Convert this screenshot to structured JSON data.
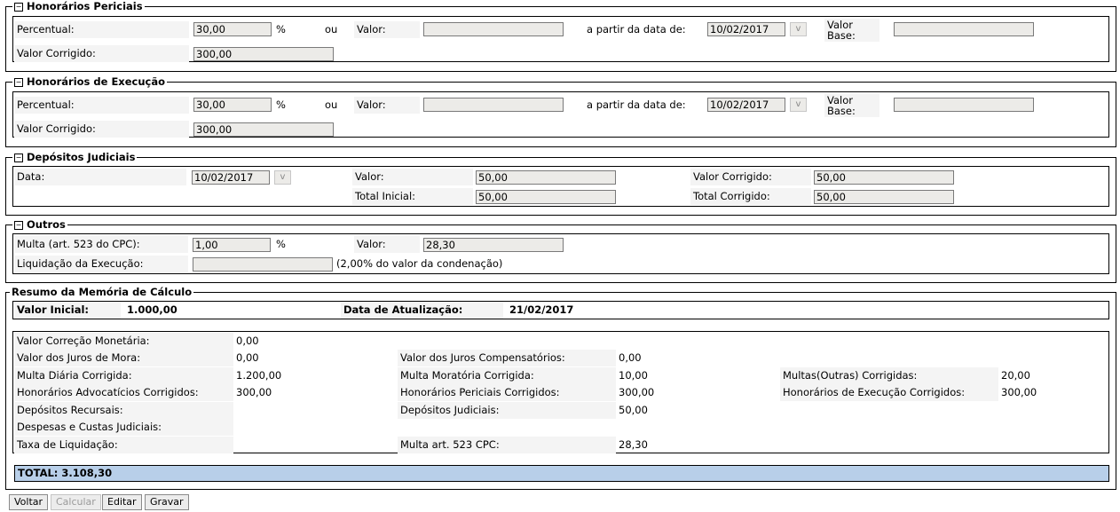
{
  "honorarios_periciais": {
    "legend": "Honorários Periciais",
    "toggle": "−",
    "percentual_label": "Percentual:",
    "percentual_value": "30,00",
    "percent_sign": "%",
    "ou": "ou",
    "valor_label": "Valor:",
    "valor_value": "",
    "data_label": "a partir da data de:",
    "data_value": "10/02/2017",
    "date_btn": "v",
    "valor_base_label_1": "Valor",
    "valor_base_label_2": "Base:",
    "valor_base_value": "",
    "valor_corrigido_label": "Valor Corrigido:",
    "valor_corrigido_value": "300,00"
  },
  "honorarios_execucao": {
    "legend": "Honorários de Execução",
    "toggle": "−",
    "percentual_label": "Percentual:",
    "percentual_value": "30,00",
    "percent_sign": "%",
    "ou": "ou",
    "valor_label": "Valor:",
    "valor_value": "",
    "data_label": "a partir da data de:",
    "data_value": "10/02/2017",
    "date_btn": "v",
    "valor_base_label_1": "Valor",
    "valor_base_label_2": "Base:",
    "valor_base_value": "",
    "valor_corrigido_label": "Valor Corrigido:",
    "valor_corrigido_value": "300,00"
  },
  "depositos_judiciais": {
    "legend": "Depósitos Judiciais",
    "toggle": "−",
    "data_label": "Data:",
    "data_value": "10/02/2017",
    "date_btn": "v",
    "valor_label": "Valor:",
    "valor_value": "50,00",
    "valor_corrigido_label": "Valor Corrigido:",
    "valor_corrigido_value": "50,00",
    "total_inicial_label": "Total Inicial:",
    "total_inicial_value": "50,00",
    "total_corrigido_label": "Total Corrigido:",
    "total_corrigido_value": "50,00"
  },
  "outros": {
    "legend": "Outros",
    "toggle": "−",
    "multa_label": "Multa (art. 523 do CPC):",
    "multa_value": "1,00",
    "percent_sign": "%",
    "valor_label": "Valor:",
    "valor_value": "28,30",
    "liquidacao_label": "Liquidação da Execução:",
    "liquidacao_value": "",
    "liquidacao_note": "(2,00% do valor da condenação)"
  },
  "resumo": {
    "legend": "Resumo da Memória de Cálculo",
    "valor_inicial_label": "Valor Inicial:",
    "valor_inicial_value": "1.000,00",
    "data_atualizacao_label": "Data de Atualização:",
    "data_atualizacao_value": "21/02/2017",
    "rows": {
      "correcao_label": "Valor Correção Monetária:",
      "correcao_value": "0,00",
      "juros_mora_label": "Valor dos Juros de Mora:",
      "juros_mora_value": "0,00",
      "juros_comp_label": "Valor dos Juros Compensatórios:",
      "juros_comp_value": "0,00",
      "multa_diaria_label": "Multa Diária Corrigida:",
      "multa_diaria_value": "1.200,00",
      "multa_moratoria_label": "Multa Moratória Corrigida:",
      "multa_moratoria_value": "10,00",
      "multas_outras_label": "Multas(Outras) Corrigidas:",
      "multas_outras_value": "20,00",
      "hon_adv_label": "Honorários Advocatícios Corrigidos:",
      "hon_adv_value": "300,00",
      "hon_per_label": "Honorários Periciais Corrigidos:",
      "hon_per_value": "300,00",
      "hon_exec_label": "Honorários de Execução Corrigidos:",
      "hon_exec_value": "300,00",
      "dep_rec_label": "Depósitos Recursais:",
      "dep_rec_value": "",
      "dep_jud_label": "Depósitos Judiciais:",
      "dep_jud_value": "50,00",
      "despesas_label": "Despesas e Custas Judiciais:",
      "despesas_value": "",
      "taxa_label": "Taxa de Liquidação:",
      "taxa_value": "",
      "multa523_label": "Multa art. 523 CPC:",
      "multa523_value": "28,30"
    },
    "total": "TOTAL: 3.108,30"
  },
  "buttons": {
    "voltar": "Voltar",
    "calcular": "Calcular",
    "editar": "Editar",
    "gravar": "Gravar"
  }
}
